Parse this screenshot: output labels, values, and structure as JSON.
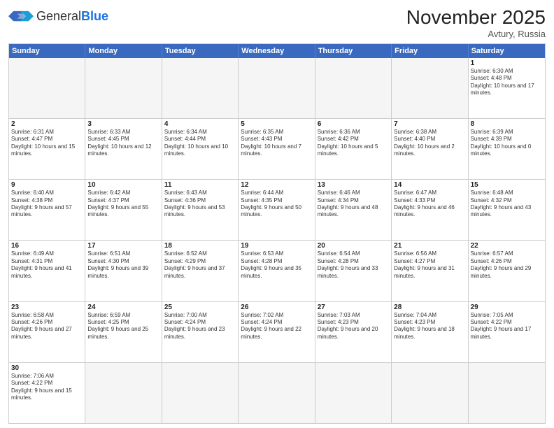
{
  "header": {
    "logo_general": "General",
    "logo_blue": "Blue",
    "month_title": "November 2025",
    "location": "Avtury, Russia"
  },
  "weekdays": [
    "Sunday",
    "Monday",
    "Tuesday",
    "Wednesday",
    "Thursday",
    "Friday",
    "Saturday"
  ],
  "rows": [
    [
      {
        "day": "",
        "text": "",
        "empty": true
      },
      {
        "day": "",
        "text": "",
        "empty": true
      },
      {
        "day": "",
        "text": "",
        "empty": true
      },
      {
        "day": "",
        "text": "",
        "empty": true
      },
      {
        "day": "",
        "text": "",
        "empty": true
      },
      {
        "day": "",
        "text": "",
        "empty": true
      },
      {
        "day": "1",
        "text": "Sunrise: 6:30 AM\nSunset: 4:48 PM\nDaylight: 10 hours and 17 minutes.",
        "empty": false
      }
    ],
    [
      {
        "day": "2",
        "text": "Sunrise: 6:31 AM\nSunset: 4:47 PM\nDaylight: 10 hours and 15 minutes.",
        "empty": false
      },
      {
        "day": "3",
        "text": "Sunrise: 6:33 AM\nSunset: 4:45 PM\nDaylight: 10 hours and 12 minutes.",
        "empty": false
      },
      {
        "day": "4",
        "text": "Sunrise: 6:34 AM\nSunset: 4:44 PM\nDaylight: 10 hours and 10 minutes.",
        "empty": false
      },
      {
        "day": "5",
        "text": "Sunrise: 6:35 AM\nSunset: 4:43 PM\nDaylight: 10 hours and 7 minutes.",
        "empty": false
      },
      {
        "day": "6",
        "text": "Sunrise: 6:36 AM\nSunset: 4:42 PM\nDaylight: 10 hours and 5 minutes.",
        "empty": false
      },
      {
        "day": "7",
        "text": "Sunrise: 6:38 AM\nSunset: 4:40 PM\nDaylight: 10 hours and 2 minutes.",
        "empty": false
      },
      {
        "day": "8",
        "text": "Sunrise: 6:39 AM\nSunset: 4:39 PM\nDaylight: 10 hours and 0 minutes.",
        "empty": false
      }
    ],
    [
      {
        "day": "9",
        "text": "Sunrise: 6:40 AM\nSunset: 4:38 PM\nDaylight: 9 hours and 57 minutes.",
        "empty": false
      },
      {
        "day": "10",
        "text": "Sunrise: 6:42 AM\nSunset: 4:37 PM\nDaylight: 9 hours and 55 minutes.",
        "empty": false
      },
      {
        "day": "11",
        "text": "Sunrise: 6:43 AM\nSunset: 4:36 PM\nDaylight: 9 hours and 53 minutes.",
        "empty": false
      },
      {
        "day": "12",
        "text": "Sunrise: 6:44 AM\nSunset: 4:35 PM\nDaylight: 9 hours and 50 minutes.",
        "empty": false
      },
      {
        "day": "13",
        "text": "Sunrise: 6:46 AM\nSunset: 4:34 PM\nDaylight: 9 hours and 48 minutes.",
        "empty": false
      },
      {
        "day": "14",
        "text": "Sunrise: 6:47 AM\nSunset: 4:33 PM\nDaylight: 9 hours and 46 minutes.",
        "empty": false
      },
      {
        "day": "15",
        "text": "Sunrise: 6:48 AM\nSunset: 4:32 PM\nDaylight: 9 hours and 43 minutes.",
        "empty": false
      }
    ],
    [
      {
        "day": "16",
        "text": "Sunrise: 6:49 AM\nSunset: 4:31 PM\nDaylight: 9 hours and 41 minutes.",
        "empty": false
      },
      {
        "day": "17",
        "text": "Sunrise: 6:51 AM\nSunset: 4:30 PM\nDaylight: 9 hours and 39 minutes.",
        "empty": false
      },
      {
        "day": "18",
        "text": "Sunrise: 6:52 AM\nSunset: 4:29 PM\nDaylight: 9 hours and 37 minutes.",
        "empty": false
      },
      {
        "day": "19",
        "text": "Sunrise: 6:53 AM\nSunset: 4:28 PM\nDaylight: 9 hours and 35 minutes.",
        "empty": false
      },
      {
        "day": "20",
        "text": "Sunrise: 6:54 AM\nSunset: 4:28 PM\nDaylight: 9 hours and 33 minutes.",
        "empty": false
      },
      {
        "day": "21",
        "text": "Sunrise: 6:56 AM\nSunset: 4:27 PM\nDaylight: 9 hours and 31 minutes.",
        "empty": false
      },
      {
        "day": "22",
        "text": "Sunrise: 6:57 AM\nSunset: 4:26 PM\nDaylight: 9 hours and 29 minutes.",
        "empty": false
      }
    ],
    [
      {
        "day": "23",
        "text": "Sunrise: 6:58 AM\nSunset: 4:26 PM\nDaylight: 9 hours and 27 minutes.",
        "empty": false
      },
      {
        "day": "24",
        "text": "Sunrise: 6:59 AM\nSunset: 4:25 PM\nDaylight: 9 hours and 25 minutes.",
        "empty": false
      },
      {
        "day": "25",
        "text": "Sunrise: 7:00 AM\nSunset: 4:24 PM\nDaylight: 9 hours and 23 minutes.",
        "empty": false
      },
      {
        "day": "26",
        "text": "Sunrise: 7:02 AM\nSunset: 4:24 PM\nDaylight: 9 hours and 22 minutes.",
        "empty": false
      },
      {
        "day": "27",
        "text": "Sunrise: 7:03 AM\nSunset: 4:23 PM\nDaylight: 9 hours and 20 minutes.",
        "empty": false
      },
      {
        "day": "28",
        "text": "Sunrise: 7:04 AM\nSunset: 4:23 PM\nDaylight: 9 hours and 18 minutes.",
        "empty": false
      },
      {
        "day": "29",
        "text": "Sunrise: 7:05 AM\nSunset: 4:22 PM\nDaylight: 9 hours and 17 minutes.",
        "empty": false
      }
    ],
    [
      {
        "day": "30",
        "text": "Sunrise: 7:06 AM\nSunset: 4:22 PM\nDaylight: 9 hours and 15 minutes.",
        "empty": false
      },
      {
        "day": "",
        "text": "",
        "empty": true
      },
      {
        "day": "",
        "text": "",
        "empty": true
      },
      {
        "day": "",
        "text": "",
        "empty": true
      },
      {
        "day": "",
        "text": "",
        "empty": true
      },
      {
        "day": "",
        "text": "",
        "empty": true
      },
      {
        "day": "",
        "text": "",
        "empty": true
      }
    ]
  ]
}
